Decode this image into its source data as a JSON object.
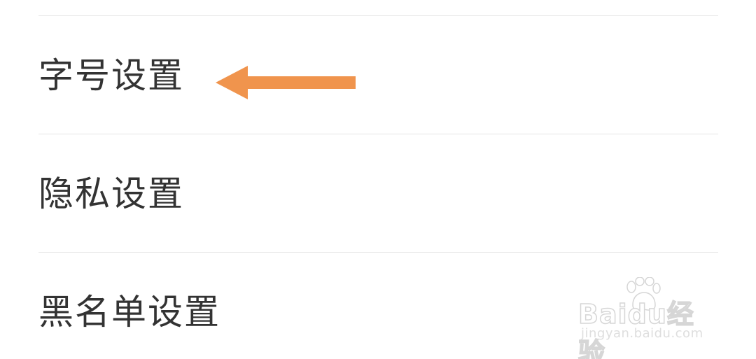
{
  "settings": {
    "items": [
      {
        "label": "字号设置"
      },
      {
        "label": "隐私设置"
      },
      {
        "label": "黑名单设置"
      }
    ]
  },
  "annotation": {
    "arrow_color": "#f0944d",
    "arrow_icon": "left-arrow-icon"
  },
  "watermark": {
    "brand": "Baidu经验",
    "url": "jingyan.baidu.com"
  },
  "colors": {
    "text": "#333333",
    "divider": "#e6e6e6",
    "background": "#ffffff"
  }
}
